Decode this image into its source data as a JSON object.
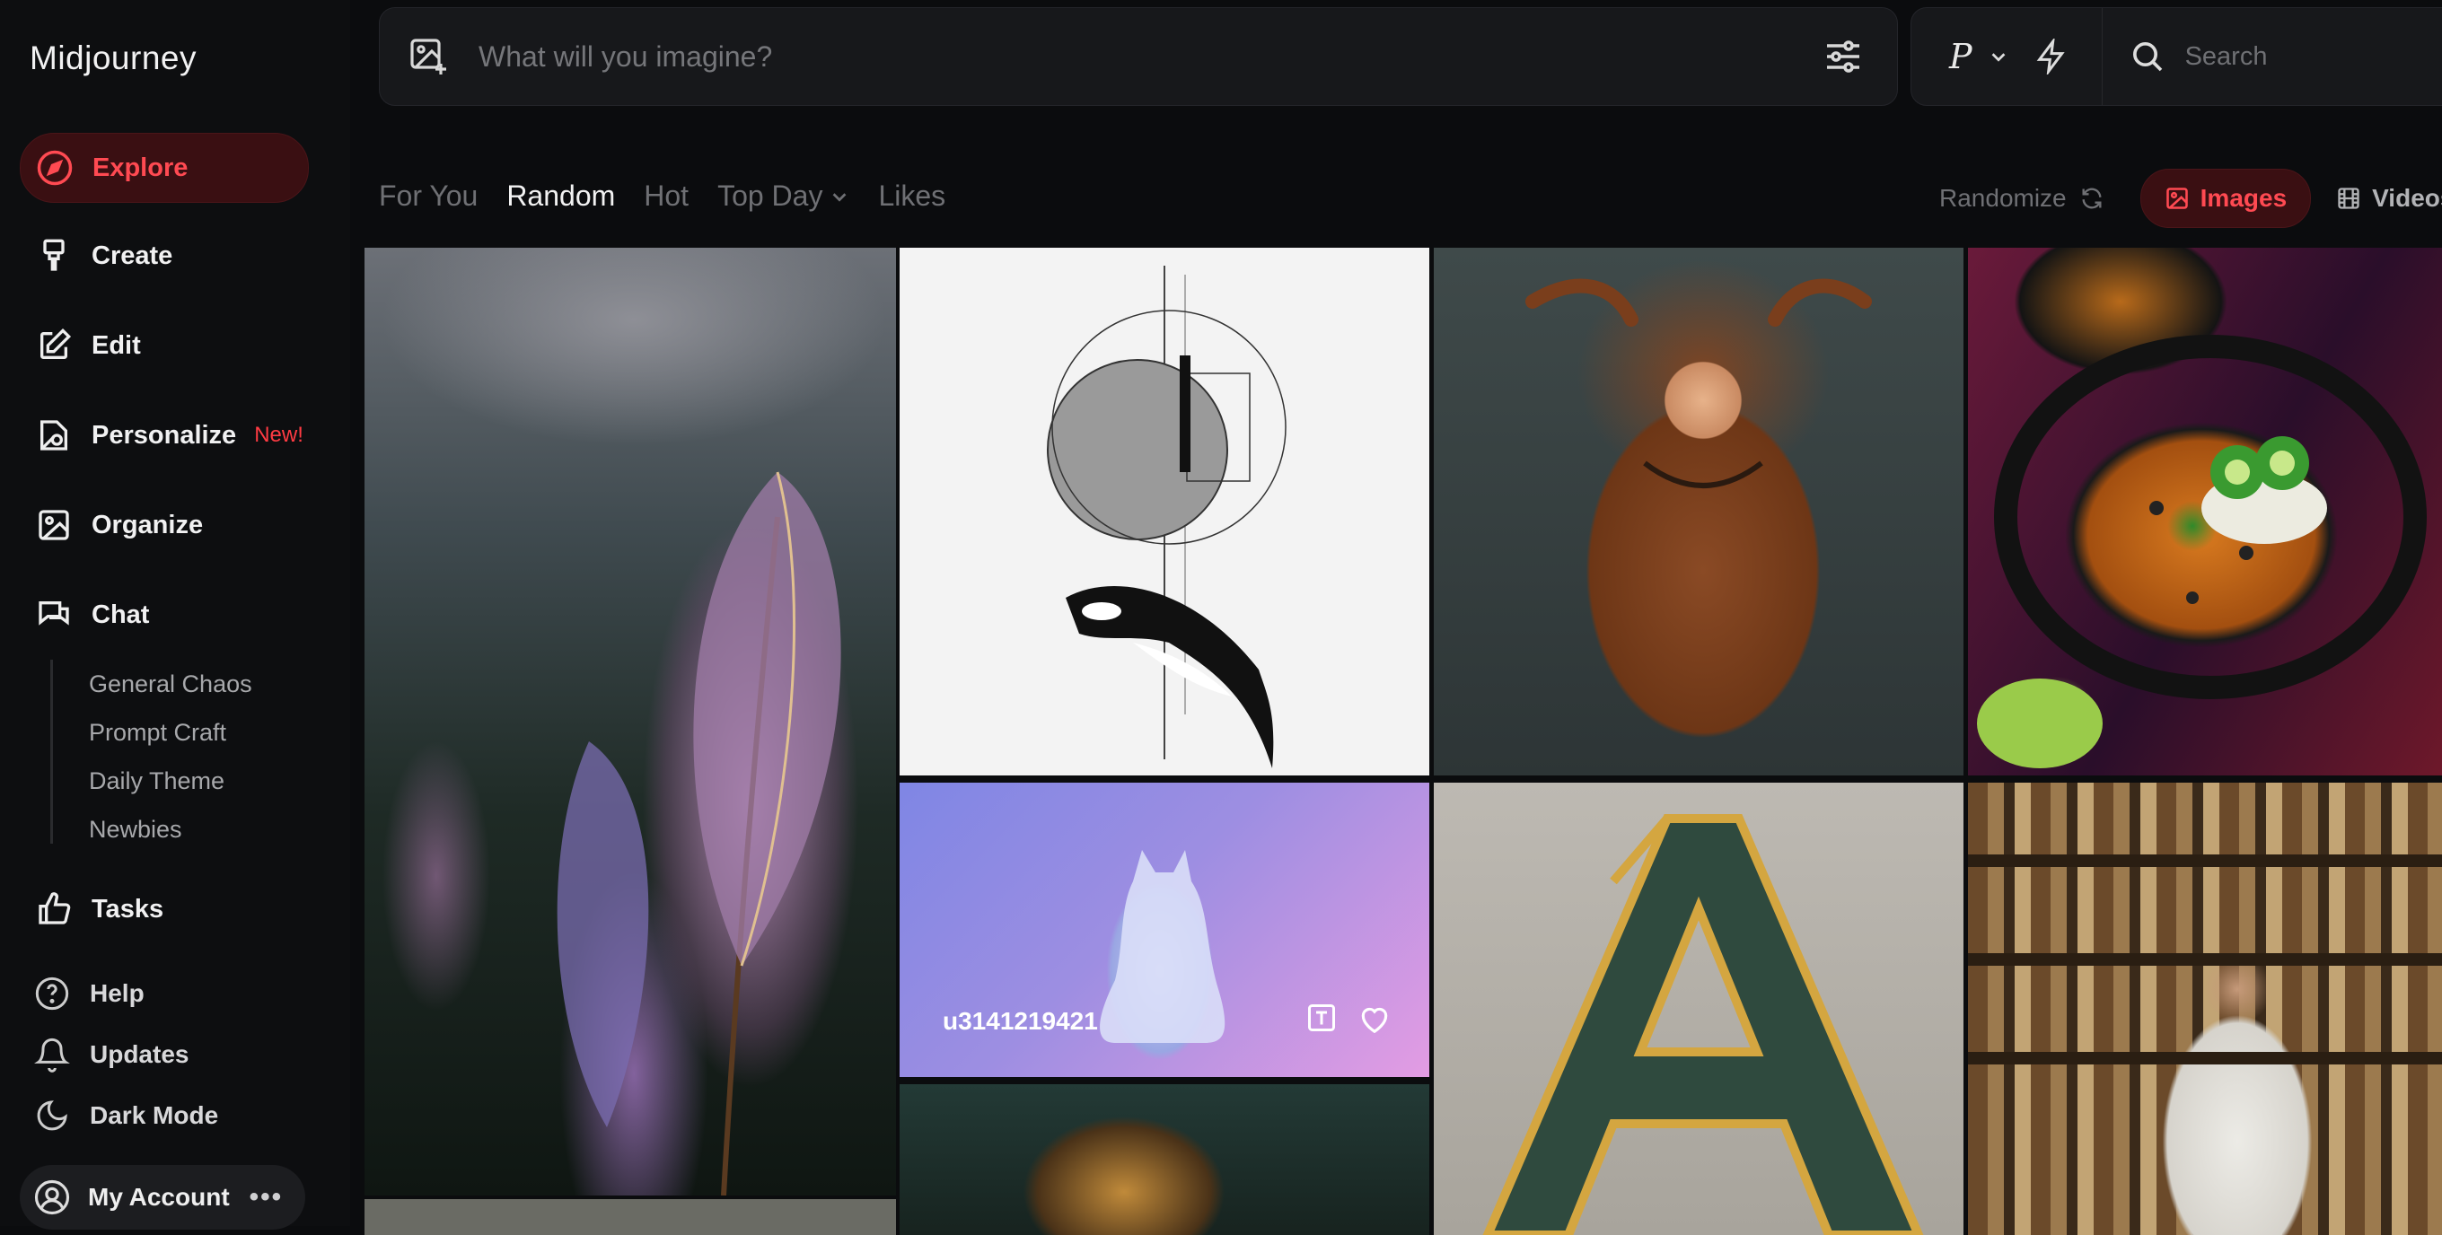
{
  "sidebar": {
    "logo": "Midjourney",
    "nav": [
      {
        "label": "Explore"
      },
      {
        "label": "Create"
      },
      {
        "label": "Edit"
      },
      {
        "label": "Personalize",
        "badge": "New!"
      },
      {
        "label": "Organize"
      },
      {
        "label": "Chat"
      }
    ],
    "chat_channels": [
      "General Chaos",
      "Prompt Craft",
      "Daily Theme",
      "Newbies"
    ],
    "tasks": "Tasks",
    "help": "Help",
    "updates": "Updates",
    "dark_mode": "Dark Mode",
    "account": "My Account"
  },
  "prompt": {
    "placeholder": "What will you imagine?"
  },
  "toolbar": {
    "version_letter": "P",
    "search_placeholder": "Search"
  },
  "tabs": {
    "for_you": "For You",
    "random": "Random",
    "hot": "Hot",
    "top_day": "Top Day",
    "likes": "Likes"
  },
  "controls": {
    "randomize": "Randomize",
    "images": "Images",
    "videos": "Videos"
  },
  "gallery": {
    "hover_username": "u3141219421"
  },
  "colors": {
    "accent": "#ff4a52",
    "background": "#0b0c0e"
  }
}
